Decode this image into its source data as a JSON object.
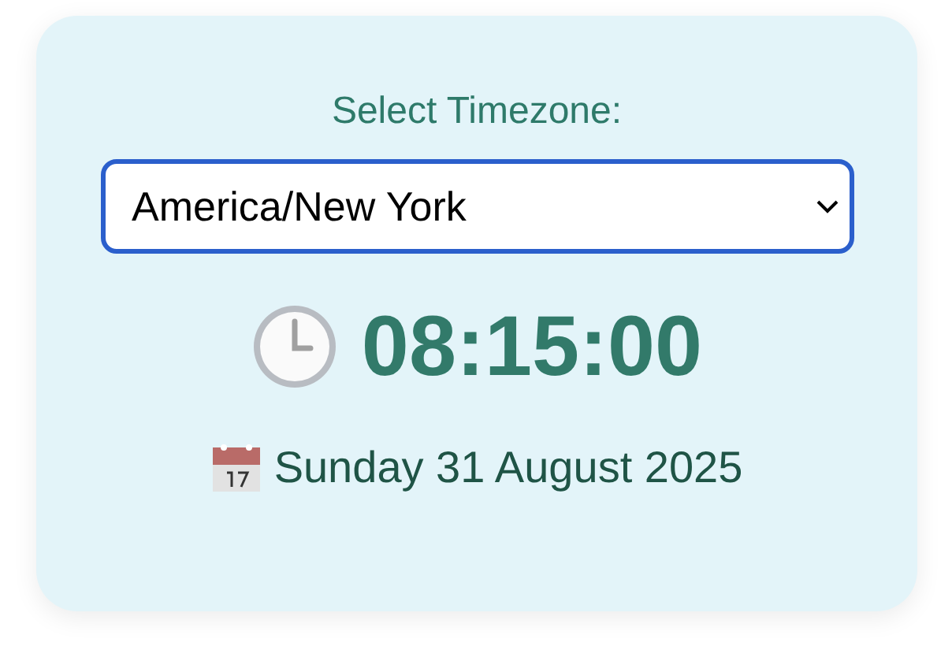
{
  "label": "Select Timezone:",
  "timezone_select": {
    "value": "America/New York",
    "focused": true
  },
  "time": "08:15:00",
  "date": "Sunday 31 August 2025"
}
